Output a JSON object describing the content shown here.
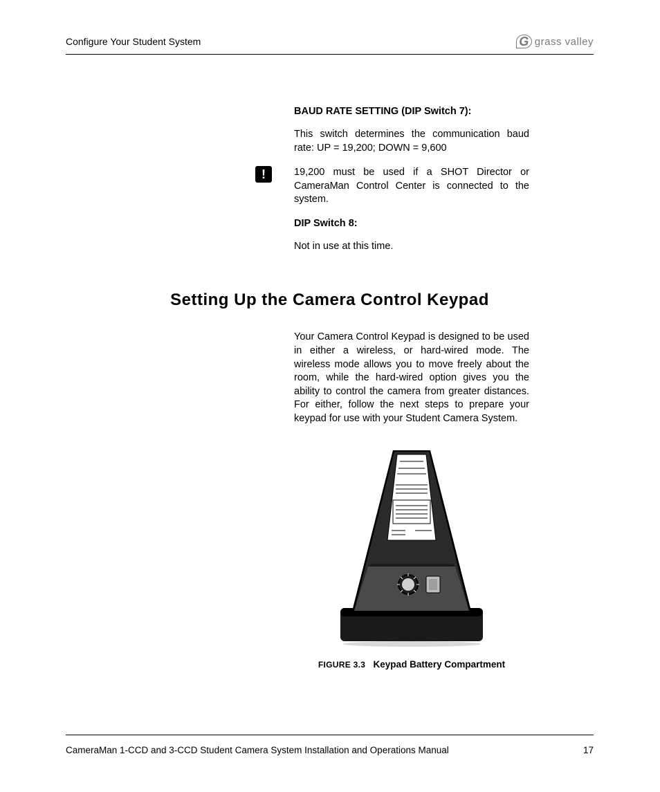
{
  "header": {
    "title": "Configure Your Student System",
    "logo_mark": "G",
    "logo_text": "grass valley"
  },
  "baud": {
    "heading": "BAUD RATE SETTING (DIP Switch 7):",
    "para": "This switch determines the communication baud rate: UP = 19,200; DOWN = 9,600",
    "alert": "19,200 must be used if a SHOT Director or CameraMan Control Center is connected to the system."
  },
  "dip8": {
    "heading": "DIP Switch 8:",
    "para": "Not in use at this time."
  },
  "section_heading": "Setting Up the Camera Control Keypad",
  "keypad_para": "Your Camera Control Keypad is designed to be used in either a wireless, or hard-wired mode. The wireless mode allows you to move freely about the room, while the hard-wired option gives you the ability to control the camera from greater distances. For either, follow the next steps to prepare your keypad for use with your Student Camera System.",
  "figure": {
    "number": "FIGURE 3.3",
    "caption": "Keypad Battery Compartment"
  },
  "footer": {
    "text": "CameraMan 1-CCD and 3-CCD Student Camera System Installation and Operations Manual",
    "page": "17"
  }
}
